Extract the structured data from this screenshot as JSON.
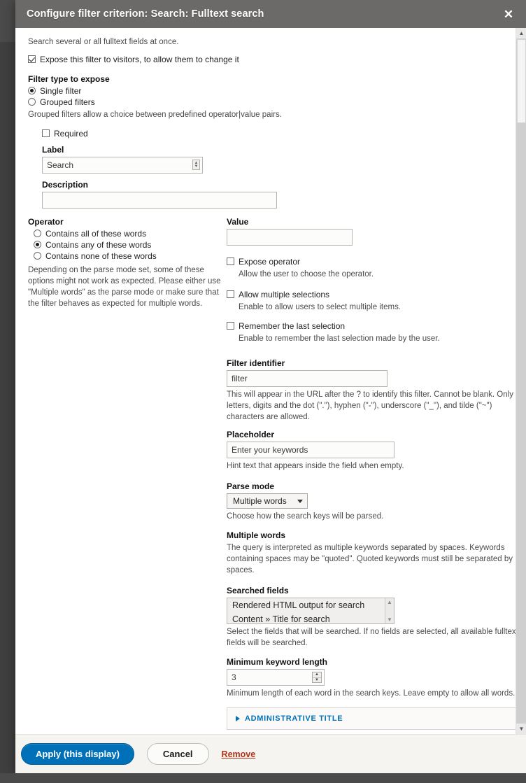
{
  "modal": {
    "title": "Configure filter criterion: Search: Fulltext search",
    "close_icon": "close-icon",
    "intro": "Search several or all fulltext fields at once.",
    "expose_checkbox": {
      "label": "Expose this filter to visitors, to allow them to change it",
      "checked": true
    },
    "filter_type": {
      "heading": "Filter type to expose",
      "options": [
        {
          "label": "Single filter",
          "selected": true
        },
        {
          "label": "Grouped filters",
          "selected": false
        }
      ],
      "hint": "Grouped filters allow a choice between predefined operator|value pairs."
    },
    "required": {
      "label": "Required",
      "checked": false
    },
    "label_field": {
      "heading": "Label",
      "value": "Search",
      "handle_icon": "autogrow-handle-icon"
    },
    "description_field": {
      "heading": "Description",
      "value": ""
    },
    "operator": {
      "heading": "Operator",
      "options": [
        {
          "label": "Contains all of these words",
          "selected": false
        },
        {
          "label": "Contains any of these words",
          "selected": true
        },
        {
          "label": "Contains none of these words",
          "selected": false
        }
      ],
      "hint": "Depending on the parse mode set, some of these options might not work as expected. Please either use \"Multiple words\" as the parse mode or make sure that the filter behaves as expected for multiple words."
    },
    "value_field": {
      "heading": "Value",
      "value": ""
    },
    "expose_operator": {
      "label": "Expose operator",
      "checked": false,
      "hint": "Allow the user to choose the operator."
    },
    "allow_multiple": {
      "label": "Allow multiple selections",
      "checked": false,
      "hint": "Enable to allow users to select multiple items."
    },
    "remember_last": {
      "label": "Remember the last selection",
      "checked": false,
      "hint": "Enable to remember the last selection made by the user."
    },
    "filter_identifier": {
      "heading": "Filter identifier",
      "value": "filter",
      "hint": "This will appear in the URL after the ? to identify this filter. Cannot be blank. Only letters, digits and the dot (\".\"), hyphen (\"-\"), underscore (\"_\"), and tilde (\"~\") characters are allowed."
    },
    "placeholder_field": {
      "heading": "Placeholder",
      "value": "Enter your keywords",
      "hint": "Hint text that appears inside the field when empty."
    },
    "parse_mode": {
      "heading": "Parse mode",
      "selected": "Multiple words",
      "caret_icon": "chevron-down-icon",
      "hint": "Choose how the search keys will be parsed.",
      "detail_heading": "Multiple words",
      "detail_text": "The query is interpreted as multiple keywords separated by spaces. Keywords containing spaces may be \"quoted\". Quoted keywords must still be separated by spaces."
    },
    "searched_fields": {
      "heading": "Searched fields",
      "options": [
        "Rendered HTML output for search",
        "Content » Title for search"
      ],
      "scroll_up_icon": "chevron-up-icon",
      "scroll_down_icon": "chevron-down-icon",
      "hint": "Select the fields that will be searched. If no fields are selected, all available fulltext fields will be searched."
    },
    "minimum_keyword_length": {
      "heading": "Minimum keyword length",
      "value": "3",
      "stepper_up_icon": "stepper-up-icon",
      "stepper_down_icon": "stepper-down-icon",
      "hint": "Minimum length of each word in the search keys. Leave empty to allow all words."
    },
    "administrative_title": {
      "summary": "ADMINISTRATIVE TITLE",
      "triangle_icon": "triangle-right-icon"
    },
    "footer": {
      "apply_label": "Apply (this display)",
      "cancel_label": "Cancel",
      "remove_label": "Remove"
    }
  },
  "scrollbar": {
    "up_icon": "scroll-up-icon",
    "down_icon": "scroll-down-icon"
  },
  "colors": {
    "header_bg": "#6b6a68",
    "primary_button": "#0071b8",
    "remove_link": "#b23218",
    "details_link": "#0071b8"
  }
}
